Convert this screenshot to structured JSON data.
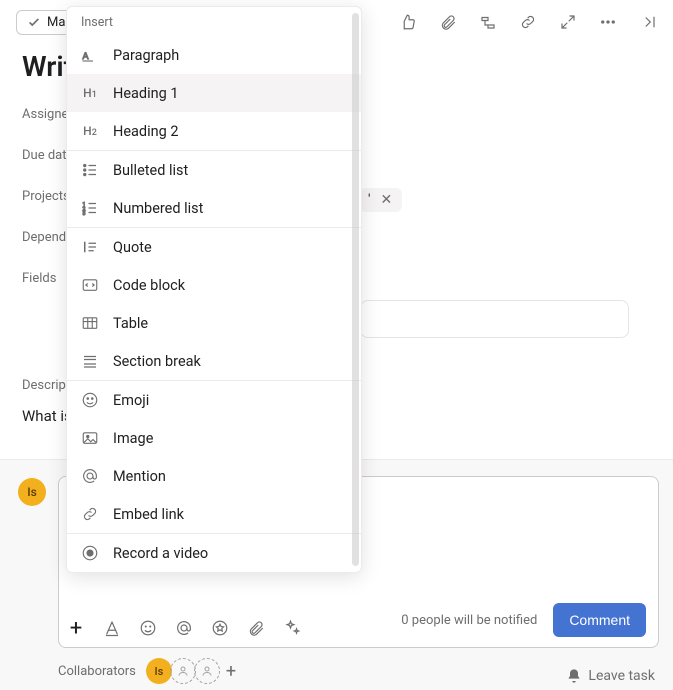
{
  "topbar": {
    "mark_label": "Mar",
    "icons": [
      "thumbs-up",
      "attachment",
      "subtask",
      "link",
      "expand",
      "more",
      "close-panel"
    ]
  },
  "title": "Writ",
  "fields": {
    "assignee_label": "Assigne",
    "due_label": "Due dat",
    "projects_label": "Projects",
    "project_pill_partial": "'",
    "dependencies_label": "Depend",
    "fields_label": "Fields"
  },
  "description": {
    "label": "Descrip",
    "body": "What is"
  },
  "insert_menu": {
    "title": "Insert",
    "groups": [
      [
        {
          "icon": "paragraph",
          "label": "Paragraph"
        },
        {
          "icon": "h1",
          "label": "Heading 1",
          "hover": true
        },
        {
          "icon": "h2",
          "label": "Heading 2"
        }
      ],
      [
        {
          "icon": "bulleted",
          "label": "Bulleted list"
        },
        {
          "icon": "numbered",
          "label": "Numbered list"
        }
      ],
      [
        {
          "icon": "quote",
          "label": "Quote"
        },
        {
          "icon": "code",
          "label": "Code block"
        },
        {
          "icon": "table",
          "label": "Table"
        },
        {
          "icon": "section",
          "label": "Section break"
        }
      ],
      [
        {
          "icon": "emoji",
          "label": "Emoji"
        },
        {
          "icon": "image",
          "label": "Image"
        },
        {
          "icon": "mention",
          "label": "Mention"
        },
        {
          "icon": "embed",
          "label": "Embed link"
        }
      ],
      [
        {
          "icon": "record",
          "label": "Record a video"
        }
      ]
    ]
  },
  "comment": {
    "avatar_initials": "Is",
    "toolbar_icons": [
      "plus",
      "text-style",
      "emoji",
      "mention",
      "star",
      "attachment",
      "ai"
    ],
    "notify_text": "0 people will be notified",
    "button_label": "Comment"
  },
  "collaborators": {
    "label": "Collaborators",
    "avatar_initials": "Is"
  },
  "leave_task_label": "Leave task"
}
